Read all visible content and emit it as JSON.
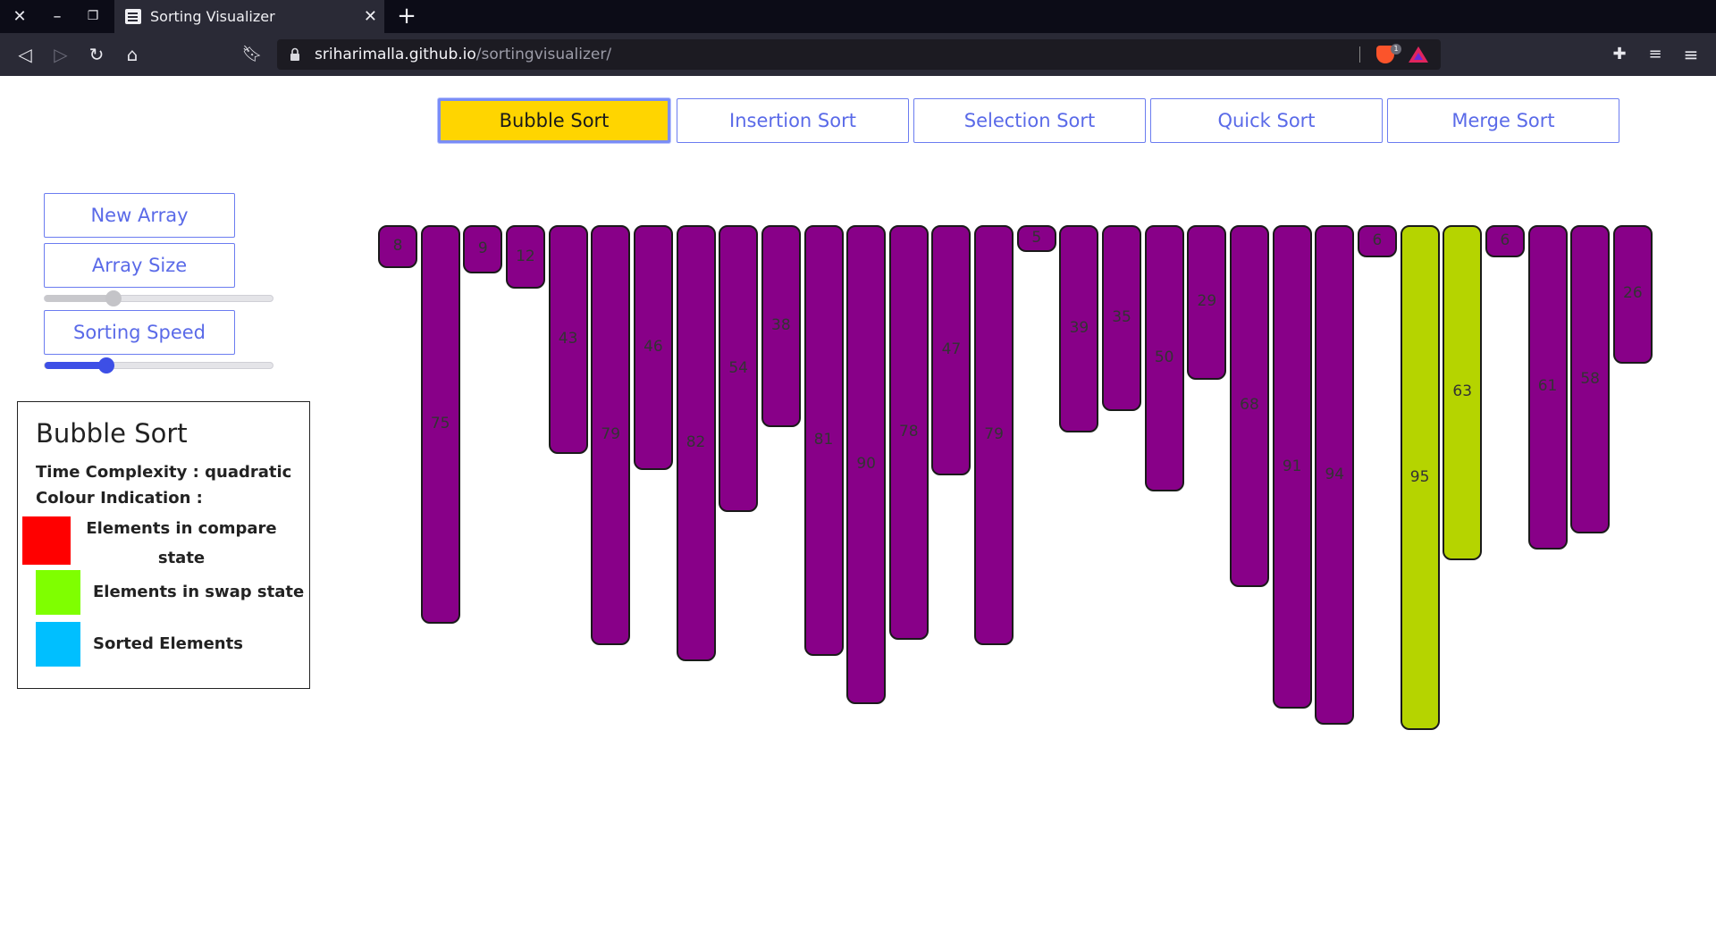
{
  "browser": {
    "tab_title": "Sorting Visualizer",
    "url_domain": "sriharimalla.github.io",
    "url_path": "/sortingvisualizer/",
    "shields_count": "1"
  },
  "algorithms": [
    {
      "label": "Bubble Sort",
      "active": true
    },
    {
      "label": "Insertion Sort",
      "active": false
    },
    {
      "label": "Selection Sort",
      "active": false
    },
    {
      "label": "Quick Sort",
      "active": false
    },
    {
      "label": "Merge Sort",
      "active": false
    }
  ],
  "controls": {
    "new_array": "New Array",
    "array_size": "Array Size",
    "array_size_level": 0.3,
    "sorting_speed": "Sorting Speed",
    "sorting_speed_level": 0.27
  },
  "legend": {
    "title": "Bubble Sort",
    "time_complexity": "Time Complexity : quadratic",
    "colour_indication": "Colour Indication :",
    "items": [
      {
        "label": "Elements in compare state",
        "color": "#ff0000"
      },
      {
        "label": "Elements in swap state",
        "color": "#7fff00"
      },
      {
        "label": "Sorted Elements",
        "color": "#00bfff"
      }
    ]
  },
  "colors": {
    "bar_default": "#880088",
    "bar_swap": "#b5d400",
    "accent": "#5a6ae8",
    "active_button": "#ffd500",
    "slider_fill": "#3d4fe6"
  },
  "array": {
    "values": [
      8,
      75,
      9,
      12,
      43,
      79,
      46,
      82,
      54,
      38,
      81,
      90,
      78,
      47,
      79,
      5,
      39,
      35,
      50,
      29,
      68,
      91,
      94,
      6,
      95,
      63,
      6,
      61,
      58,
      26
    ],
    "highlighted_indices": [
      24,
      25
    ]
  }
}
